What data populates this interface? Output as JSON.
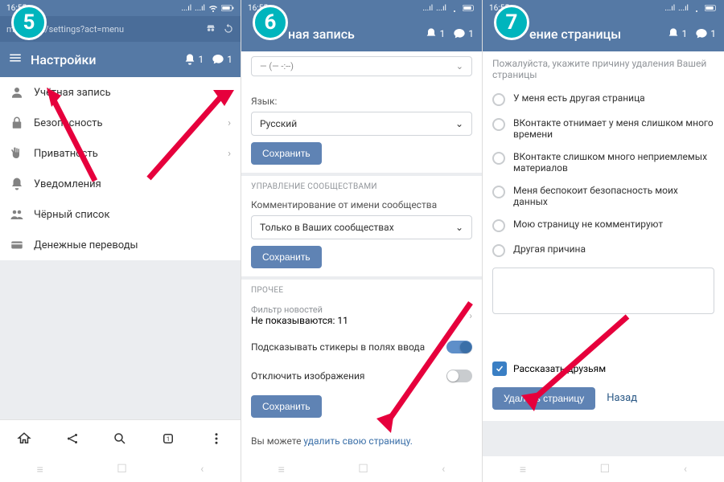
{
  "status": {
    "time": "16:55",
    "sig1": "...ıl",
    "sig2": "...ıl"
  },
  "pane1": {
    "step": "5",
    "url": "m.vk.com/settings?act=menu",
    "title": "Настройки",
    "bell_count": "1",
    "chat_count": "1",
    "items": [
      {
        "label": "Учётная запись"
      },
      {
        "label": "Безопасность"
      },
      {
        "label": "Приватность"
      },
      {
        "label": "Уведомления"
      },
      {
        "label": "Чёрный список"
      },
      {
        "label": "Денежные переводы"
      }
    ]
  },
  "pane2": {
    "step": "6",
    "title_fragment": "ная запись",
    "bell_count": "1",
    "chat_count": "1",
    "lang_label": "Язык:",
    "lang_value": "Русский",
    "save": "Сохранить",
    "section_comm": "УПРАВЛЕНИЕ СООБЩЕСТВАМИ",
    "comm_label": "Комментирование от имени сообщества",
    "comm_value": "Только в Ваших сообществах",
    "section_other": "ПРОЧЕЕ",
    "filter_label": "Фильтр новостей",
    "filter_value": "Не показываются: 11",
    "stickers": "Подсказывать стикеры в полях ввода",
    "images_off": "Отключить изображения",
    "footer_prefix": "Вы можете ",
    "footer_link": "удалить свою страницу."
  },
  "pane3": {
    "step": "7",
    "title_fragment": "ение страницы",
    "bell_count": "1",
    "chat_count": "1",
    "desc": "Пожалуйста, укажите причину удаления Вашей страницы",
    "reasons": [
      "У меня есть другая страница",
      "ВКонтакте отнимает у меня слишком много времени",
      "ВКонтакте слишком много неприемлемых материалов",
      "Меня беспокоит безопасность моих данных",
      "Мою страницу не комментируют",
      "Другая причина"
    ],
    "tell_friends": "Рассказать друзьям",
    "delete": "Удалить страницу",
    "back": "Назад"
  }
}
